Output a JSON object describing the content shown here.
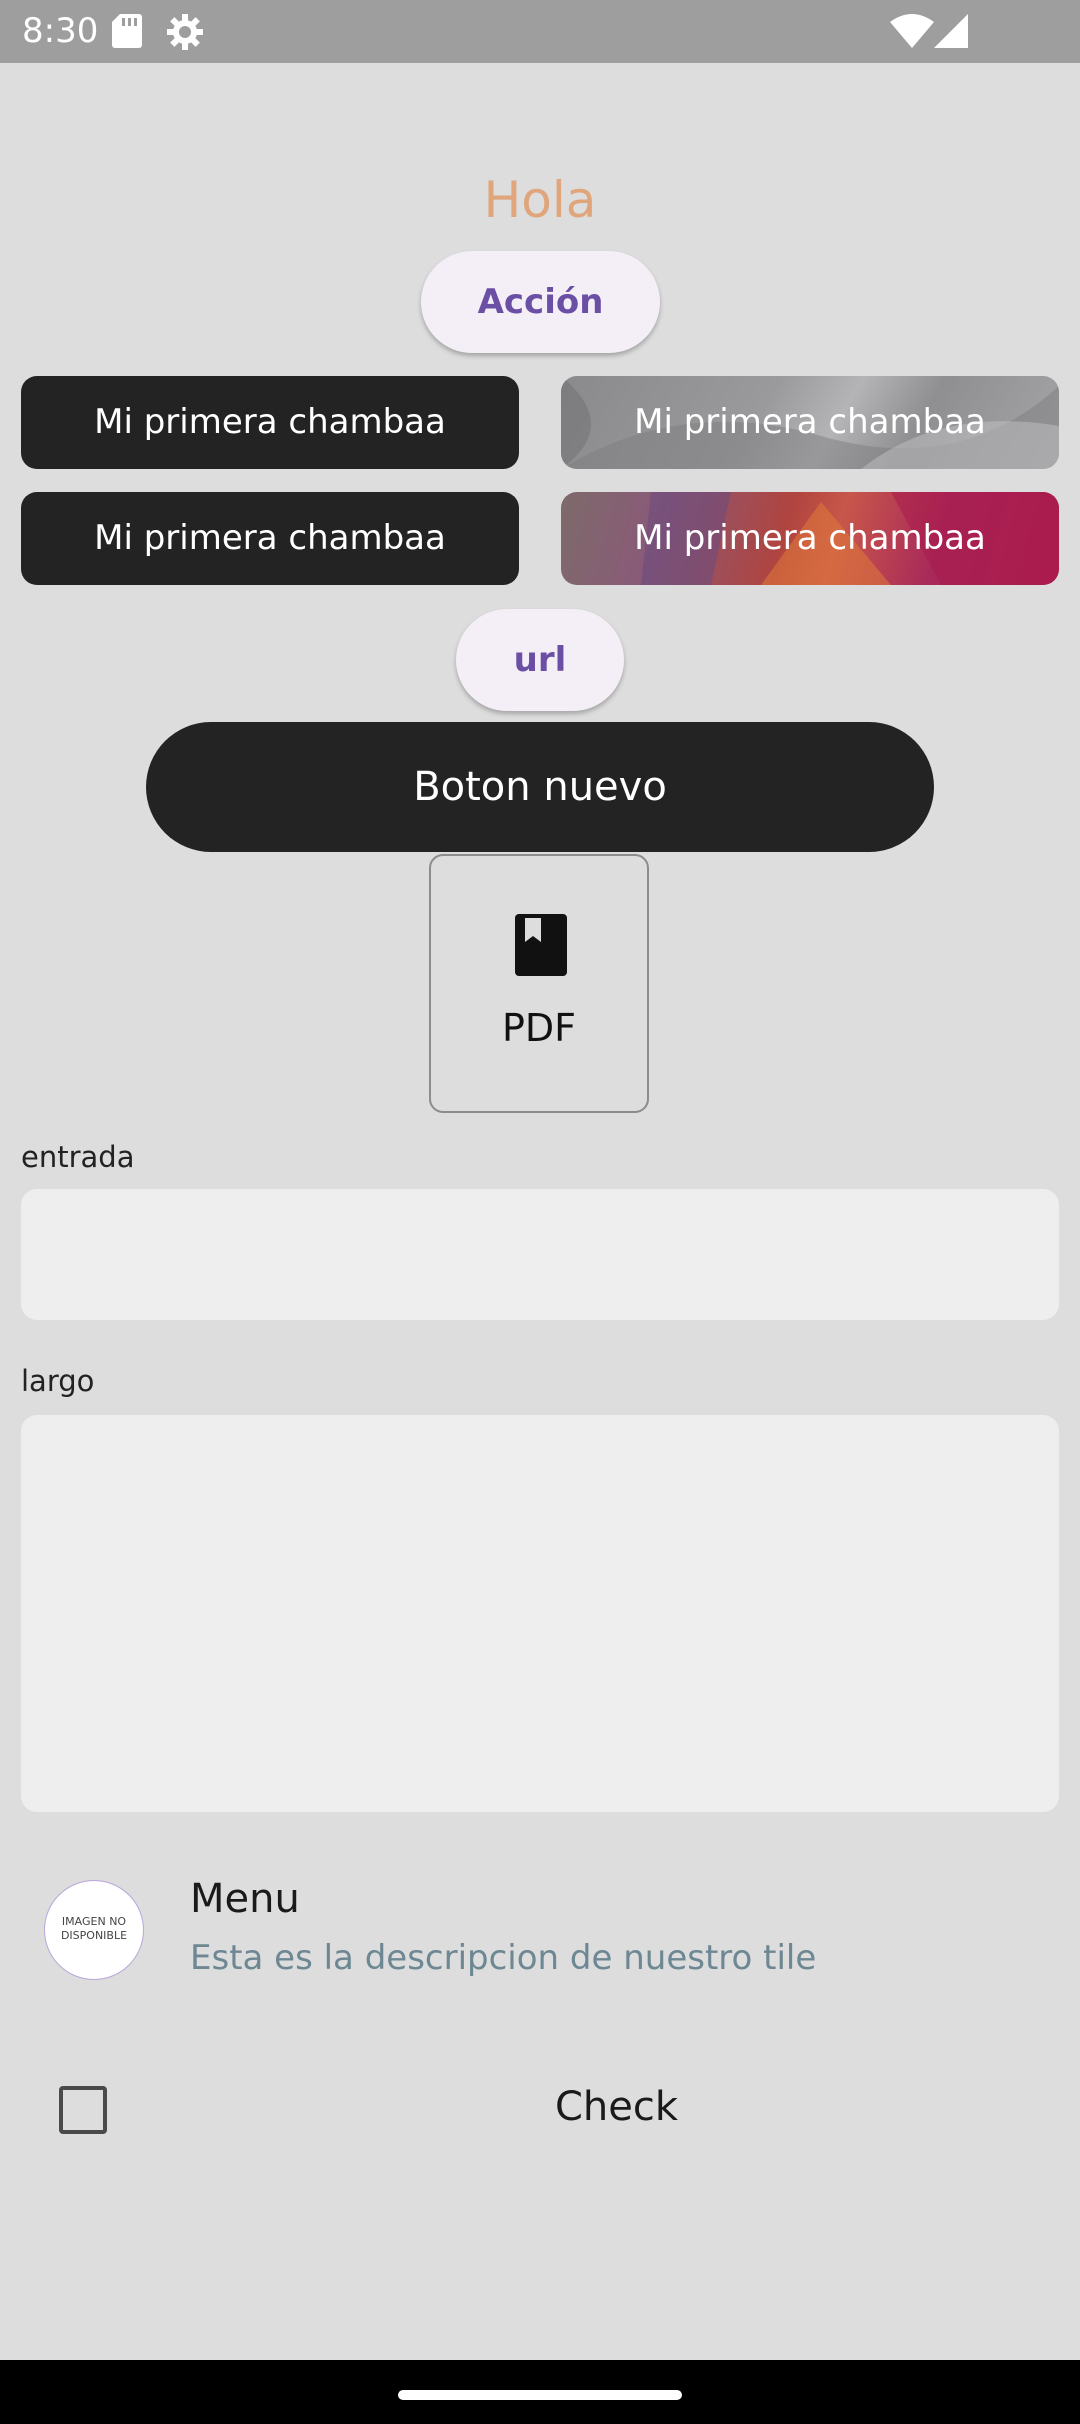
{
  "status_bar": {
    "time": "8:30",
    "icons": [
      "sd-card-icon",
      "settings-gear-icon",
      "wifi-icon",
      "signal-icon"
    ]
  },
  "greeting": "Hola",
  "colors": {
    "greeting": "#e0a57b",
    "accent": "#6a4fa5",
    "dark_button": "#232323",
    "subtitle": "#6d8793"
  },
  "buttons": {
    "accion_label": "Acción",
    "chambaa_1": "Mi primera chambaa",
    "chambaa_2": "Mi primera chambaa",
    "chambaa_3": "Mi primera chambaa",
    "chambaa_4": "Mi primera chambaa",
    "url_label": "url",
    "boton_nuevo_label": "Boton nuevo",
    "pdf_label": "PDF"
  },
  "fields": {
    "entrada_label": "entrada",
    "entrada_value": "",
    "largo_label": "largo",
    "largo_value": ""
  },
  "list_tile": {
    "avatar_text": "IMAGEN NO\nDISPONIBLE",
    "title": "Menu",
    "subtitle": "Esta es la descripcion de nuestro tile"
  },
  "checkbox": {
    "label": "Check",
    "checked": false
  }
}
